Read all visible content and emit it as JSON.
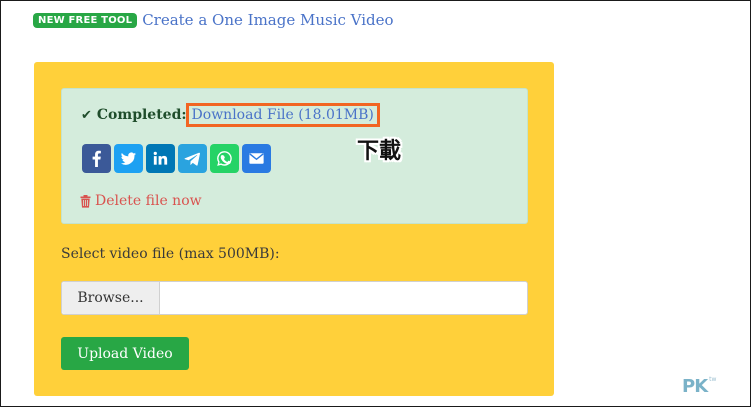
{
  "promo": {
    "badge": "NEW FREE TOOL",
    "link": "Create a One Image Music Video"
  },
  "result": {
    "completed_label": "Completed:",
    "download_link": "Download File (18.01MB)",
    "delete_link": "Delete file now",
    "share_buttons": [
      {
        "name": "facebook",
        "color": "#3b5998"
      },
      {
        "name": "twitter",
        "color": "#1da1f2"
      },
      {
        "name": "linkedin",
        "color": "#0077b5"
      },
      {
        "name": "telegram",
        "color": "#2aa3df"
      },
      {
        "name": "whatsapp",
        "color": "#25d366"
      },
      {
        "name": "email",
        "color": "#2a7ae2"
      }
    ]
  },
  "annotation": "下載",
  "upload": {
    "select_label": "Select video file (max 500MB):",
    "browse_label": "Browse...",
    "upload_button": "Upload Video"
  },
  "watermark": {
    "text": "PK",
    "sub": "tw"
  },
  "colors": {
    "card": "#ffd03a",
    "alert": "#d4ecdc",
    "accent_green": "#28a745",
    "highlight": "#f26522",
    "link": "#4a73c8",
    "danger": "#d9534f"
  }
}
